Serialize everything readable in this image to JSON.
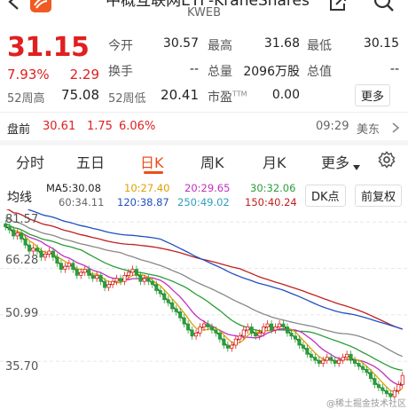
{
  "header": {
    "title": "中概互联网ETF-KraneShares",
    "ticker": "KWEB"
  },
  "quote": {
    "price": "31.15",
    "change_pct": "7.93%",
    "change": "2.29",
    "open_label": "今开",
    "open": "30.57",
    "high_label": "最高",
    "high": "31.68",
    "low_label": "最低",
    "low": "30.15",
    "turnover_label": "换手",
    "turnover": "--",
    "volume_label": "总量",
    "volume": "2096万股",
    "mktcap_label": "总值",
    "mktcap": "--",
    "w52h_label": "52周高",
    "w52h": "75.08",
    "w52l_label": "52周低",
    "w52l": "20.41",
    "pe_label": "市盈",
    "pe_sup": "TTM",
    "pe": "0.00",
    "more_label": "更多"
  },
  "premarket": {
    "label": "盘前",
    "price": "30.61",
    "change": "1.75",
    "pct": "6.06%",
    "time": "09:29",
    "zone": "美东"
  },
  "tabs": [
    "分时",
    "五日",
    "日K",
    "周K",
    "月K",
    "更多"
  ],
  "active_tab": "日K",
  "ma": {
    "label": "均线",
    "ma5": "MA5:30.08",
    "ma10": "10:27.40",
    "ma20": "20:29.65",
    "ma30": "30:32.06",
    "ma60": "60:34.11",
    "ma120": "120:38.87",
    "ma250": "250:49.02",
    "ma150": "150:40.24",
    "dk_label": "DK点",
    "adj_label": "前复权"
  },
  "chart_data": {
    "type": "candlestick",
    "y_ticks": [
      "81.57",
      "66.28",
      "50.99",
      "35.70"
    ],
    "close": [
      80,
      79,
      77,
      78,
      76,
      74,
      72,
      73,
      72,
      70,
      71,
      72,
      70,
      68,
      66,
      67,
      68,
      66,
      64,
      65,
      66,
      64,
      63,
      64,
      62,
      60,
      61,
      62,
      63,
      62,
      64,
      65,
      66,
      64,
      62,
      63,
      62,
      61,
      59,
      58,
      56,
      55,
      53,
      52,
      50,
      48,
      46,
      44,
      45,
      47,
      48,
      47,
      46,
      45,
      43,
      41,
      40,
      41,
      43,
      44,
      46,
      47,
      45,
      44,
      45,
      47,
      48,
      46,
      47,
      48,
      47,
      45,
      44,
      43,
      41,
      40,
      38,
      37,
      36,
      35,
      36,
      37,
      36,
      35,
      36,
      37,
      38,
      36,
      35,
      34,
      33,
      32,
      30,
      28,
      27,
      26,
      25,
      24,
      26,
      28,
      31
    ],
    "ylim": [
      22,
      84
    ]
  },
  "colors": {
    "accent": "#e8501b",
    "up": "#e02020",
    "down": "#2a9d3a"
  },
  "watermark": "@稀土掘金技术社区"
}
